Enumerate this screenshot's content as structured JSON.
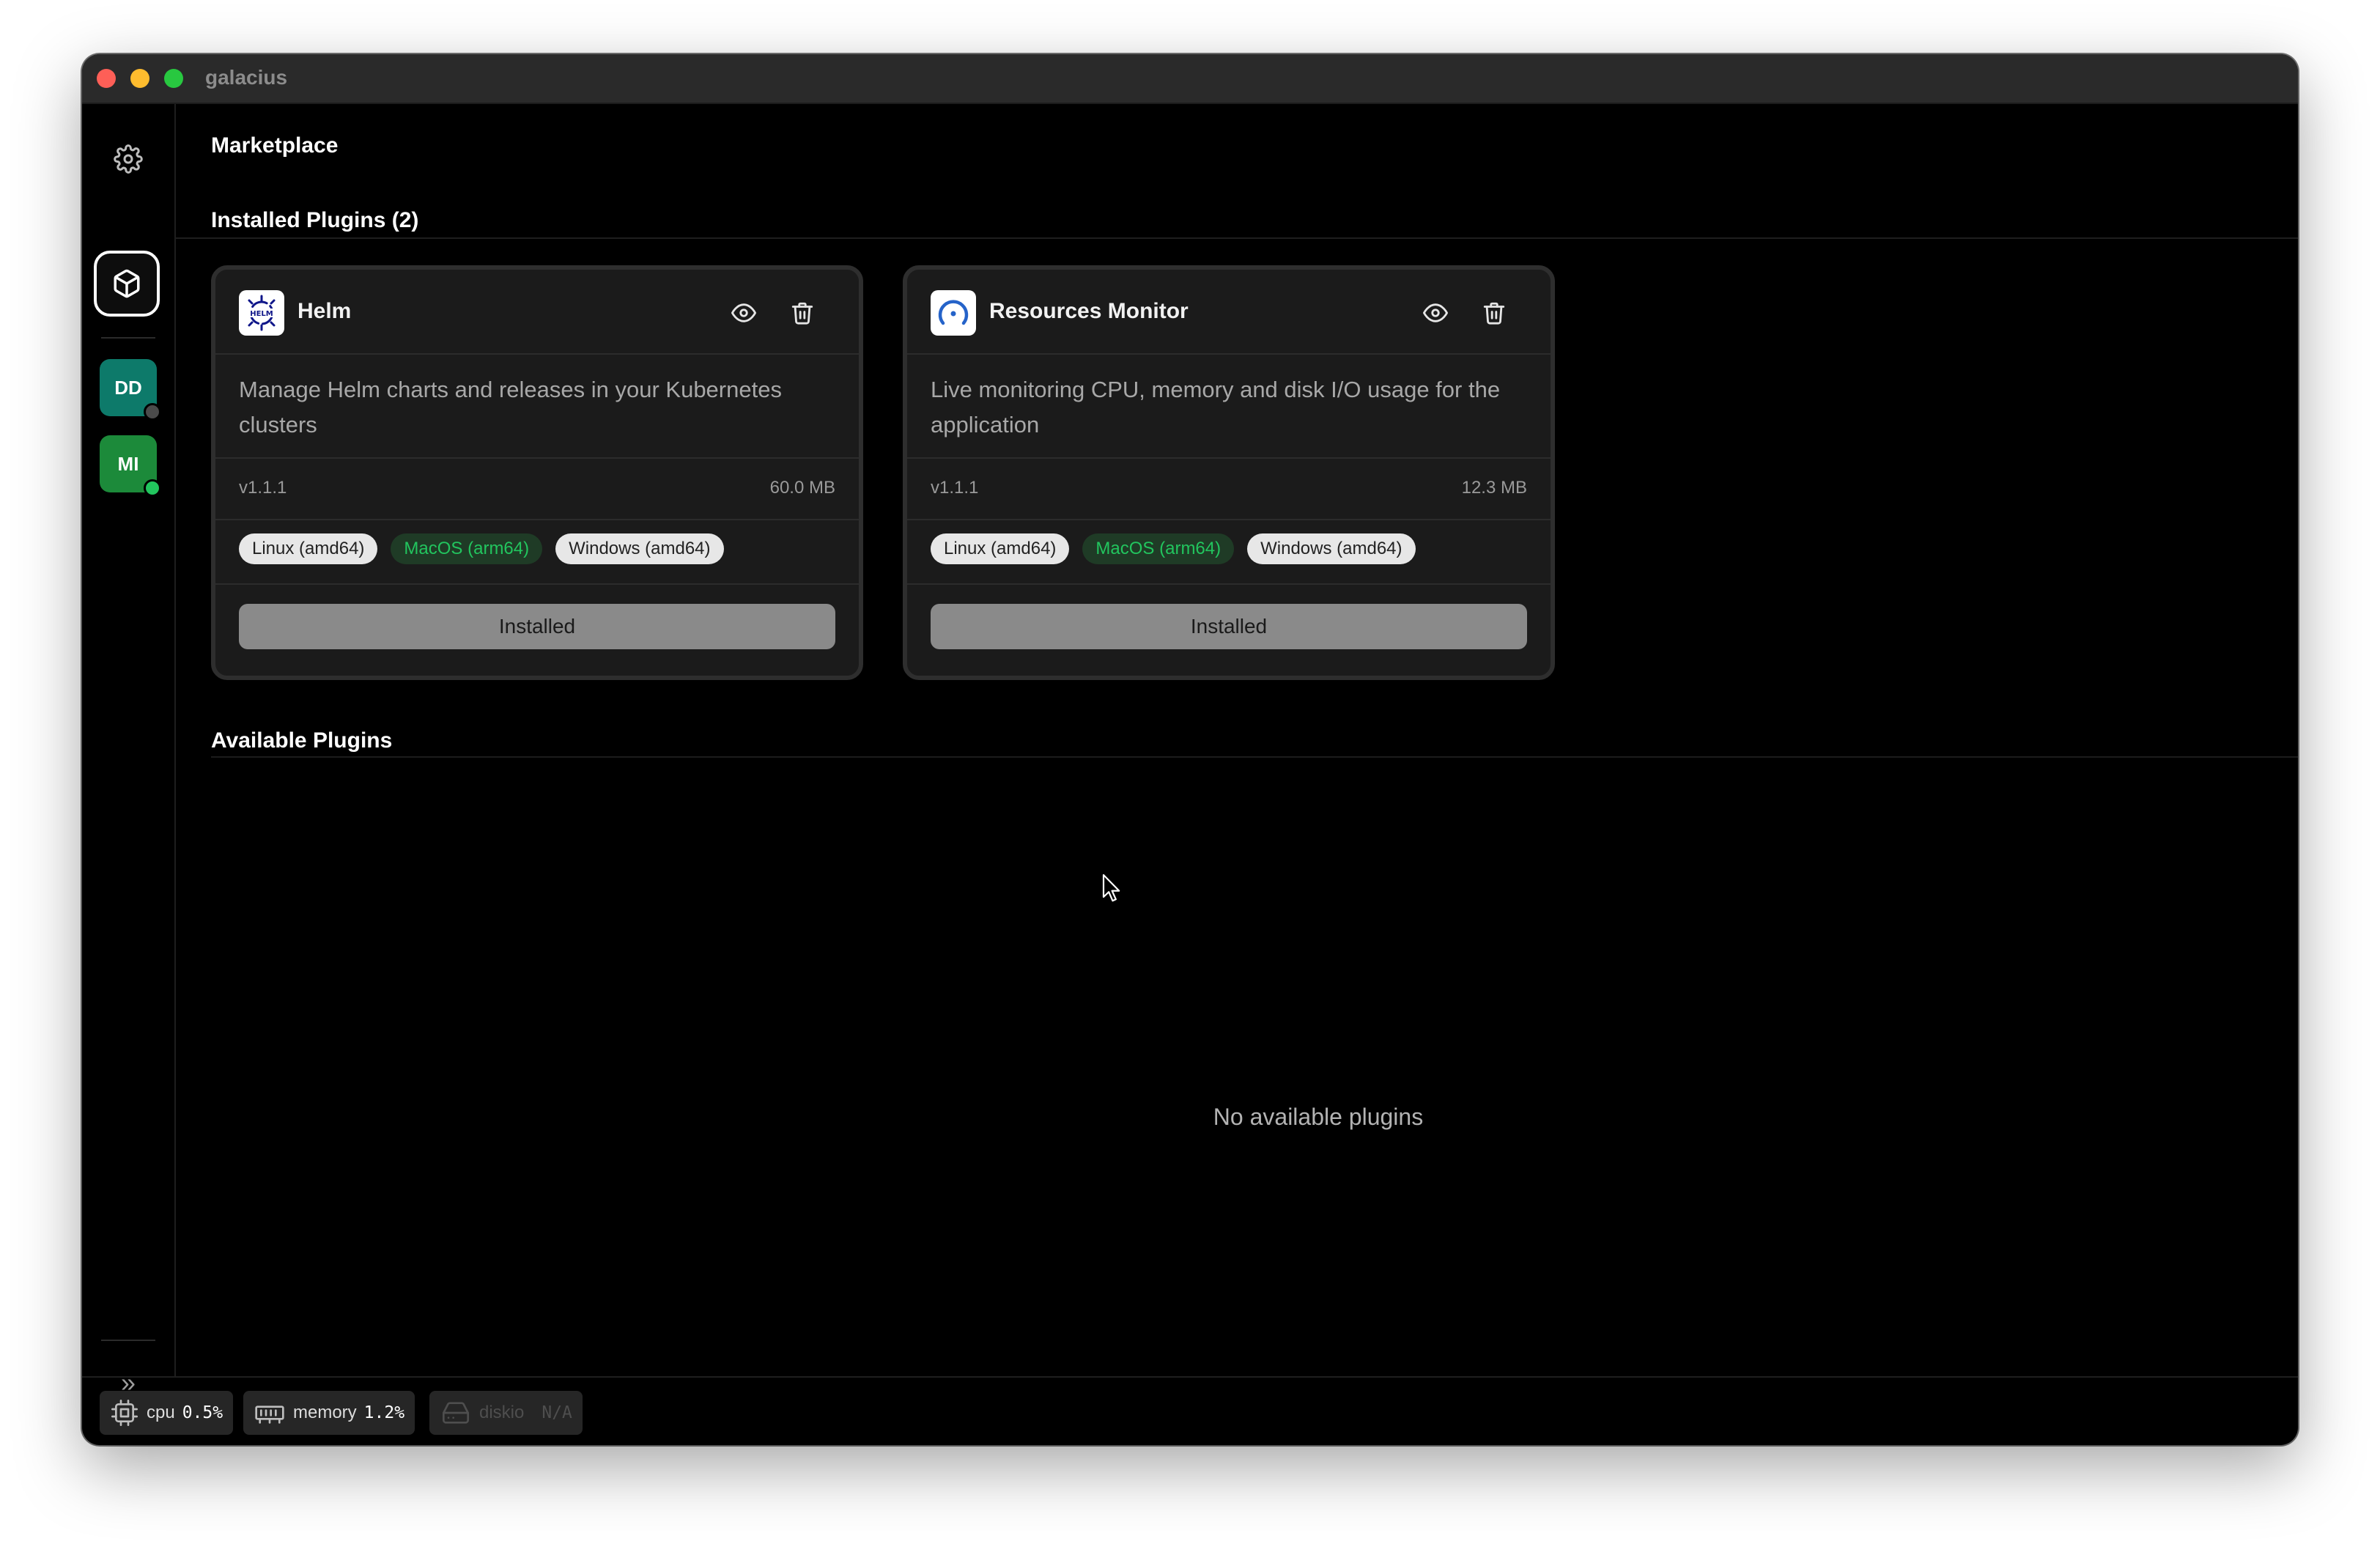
{
  "window": {
    "title": "galacius"
  },
  "sidebar": {
    "items": [
      {
        "name": "settings",
        "icon": "gear-icon"
      },
      {
        "name": "marketplace",
        "icon": "package-icon",
        "active": true
      }
    ],
    "clusters": [
      {
        "initials": "DD",
        "color": "#0d7a6a",
        "status_color": "#4b4b4b"
      },
      {
        "initials": "MI",
        "color": "#1c8a3a",
        "status_color": "#22c55e"
      }
    ],
    "expand_icon": "chevrons-right-icon",
    "expand_glyph": "»"
  },
  "header": {
    "title": "Marketplace"
  },
  "installed": {
    "title": "Installed Plugins (2)",
    "plugins": [
      {
        "name": "Helm",
        "logo": "helm-icon",
        "description": "Manage Helm charts and releases in your Kubernetes clusters",
        "version": "v1.1.1",
        "size": "60.0 MB",
        "tags": [
          {
            "label": "Linux (amd64)",
            "active": false
          },
          {
            "label": "MacOS (arm64)",
            "active": true
          },
          {
            "label": "Windows (amd64)",
            "active": false
          }
        ],
        "button_label": "Installed"
      },
      {
        "name": "Resources Monitor",
        "logo": "gauge-icon",
        "description": "Live monitoring CPU, memory and disk I/O usage for the application",
        "version": "v1.1.1",
        "size": "12.3 MB",
        "tags": [
          {
            "label": "Linux (amd64)",
            "active": false
          },
          {
            "label": "MacOS (arm64)",
            "active": true
          },
          {
            "label": "Windows (amd64)",
            "active": false
          }
        ],
        "button_label": "Installed"
      }
    ]
  },
  "available": {
    "title": "Available Plugins",
    "empty_message": "No available plugins"
  },
  "status": {
    "cpu": {
      "label": "cpu",
      "value": "0.5%"
    },
    "memory": {
      "label": "memory",
      "value": "1.2%"
    },
    "diskio": {
      "label": "diskio",
      "value": "N/A"
    }
  },
  "colors": {
    "accent_green": "#22c55e",
    "background": "#000000"
  }
}
